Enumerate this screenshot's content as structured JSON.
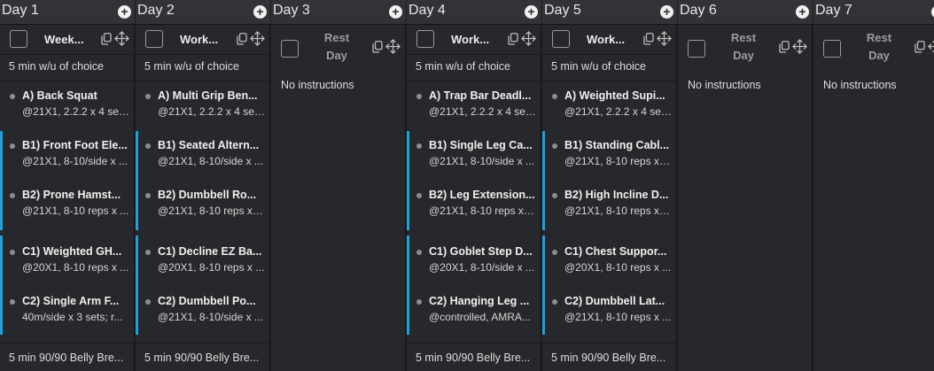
{
  "accent_color": "#1aa3db",
  "icons": {
    "add": "plus-circle-icon",
    "copy": "copy-icon",
    "move": "move-arrows-icon",
    "checkbox": "checkbox-icon"
  },
  "days": [
    {
      "title": "Day 1",
      "workout": "Week...",
      "rest": false,
      "warmup": "5 min w/u of choice",
      "exercises": [
        {
          "name": "A) Back Squat",
          "detail": "@21X1, 2.2.2 x 4 set..."
        },
        {
          "name": "B1) Front Foot Ele...",
          "detail": "@21X1, 8-10/side x ..."
        },
        {
          "name": "B2) Prone Hamst...",
          "detail": "@21X1, 8-10 reps x ..."
        },
        {
          "name": "C1) Weighted GH...",
          "detail": "@20X1, 8-10 reps x ..."
        },
        {
          "name": "C2) Single Arm F...",
          "detail": "40m/side x 3 sets; r..."
        }
      ],
      "cooldown": "5 min 90/90 Belly Bre..."
    },
    {
      "title": "Day 2",
      "workout": "Work...",
      "rest": false,
      "warmup": "5 min w/u of choice",
      "exercises": [
        {
          "name": "A) Multi Grip Ben...",
          "detail": "@21X1, 2.2.2 x 4 set..."
        },
        {
          "name": "B1) Seated Altern...",
          "detail": "@21X1, 8-10/side x ..."
        },
        {
          "name": "B2) Dumbbell Ro...",
          "detail": "@21X1, 8-10 reps x 3..."
        },
        {
          "name": "C1) Decline EZ Ba...",
          "detail": "@20X1, 8-10 reps x ..."
        },
        {
          "name": "C2) Dumbbell Po...",
          "detail": "@21X1, 8-10/side x ..."
        }
      ],
      "cooldown": "5 min 90/90 Belly Bre..."
    },
    {
      "title": "Day 3",
      "workout": "Rest Day",
      "rest": true,
      "no_instructions": "No instructions"
    },
    {
      "title": "Day 4",
      "workout": "Work...",
      "rest": false,
      "warmup": "5 min w/u of choice",
      "exercises": [
        {
          "name": "A) Trap Bar Deadl...",
          "detail": "@21X1, 2.2.2 x 4 set..."
        },
        {
          "name": "B1) Single Leg Ca...",
          "detail": "@21X1, 8-10/side x ..."
        },
        {
          "name": "B2) Leg Extension...",
          "detail": "@21X1, 8-10 reps x 3..."
        },
        {
          "name": "C1) Goblet Step D...",
          "detail": "@20X1, 8-10/side x ..."
        },
        {
          "name": "C2) Hanging Leg ...",
          "detail": "@controlled, AMRA..."
        }
      ],
      "cooldown": "5 min 90/90 Belly Bre..."
    },
    {
      "title": "Day 5",
      "workout": "Work...",
      "rest": false,
      "warmup": "5 min w/u of choice",
      "exercises": [
        {
          "name": "A) Weighted Supi...",
          "detail": "@21X1, 2.2.2 x 4 set..."
        },
        {
          "name": "B1) Standing Cabl...",
          "detail": "@21X1, 8-10 reps x 3..."
        },
        {
          "name": "B2) High Incline D...",
          "detail": "@21X1, 8-10 reps x 3..."
        },
        {
          "name": "C1) Chest Suppor...",
          "detail": "@20X1, 8-10 reps x ..."
        },
        {
          "name": "C2) Dumbbell Lat...",
          "detail": "@21X1, 8-10 reps x ..."
        }
      ],
      "cooldown": "5 min 90/90 Belly Bre..."
    },
    {
      "title": "Day 6",
      "workout": "Rest Day",
      "rest": true,
      "no_instructions": "No instructions"
    },
    {
      "title": "Day 7",
      "workout": "Rest Day",
      "rest": true,
      "no_instructions": "No instructions"
    }
  ]
}
